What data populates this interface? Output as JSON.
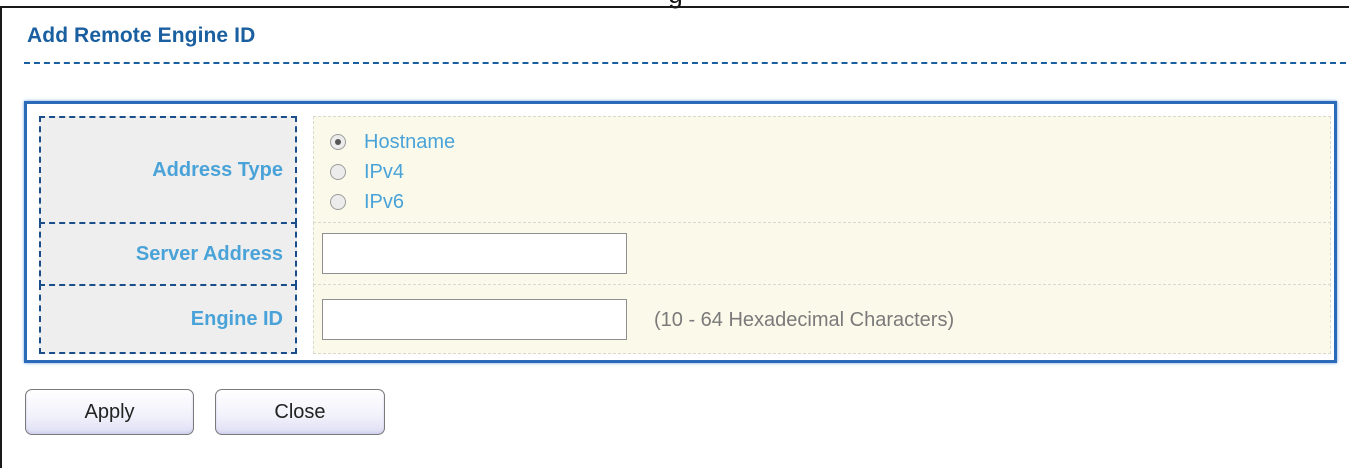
{
  "header": {
    "clipped_title": "g"
  },
  "page": {
    "title": "Add Remote Engine ID"
  },
  "form": {
    "address_type": {
      "label": "Address Type",
      "options": [
        {
          "label": "Hostname",
          "checked": true
        },
        {
          "label": "IPv4",
          "checked": false
        },
        {
          "label": "IPv6",
          "checked": false
        }
      ]
    },
    "server_address": {
      "label": "Server Address",
      "value": ""
    },
    "engine_id": {
      "label": "Engine ID",
      "value": "",
      "hint": "(10 - 64 Hexadecimal Characters)"
    }
  },
  "buttons": {
    "apply_label": "Apply",
    "close_label": "Close"
  },
  "colors": {
    "title": "#1a5fa0",
    "label": "#4aa3d8",
    "frame_border": "#2a6ab8",
    "value_bg": "#fbf9ea"
  }
}
